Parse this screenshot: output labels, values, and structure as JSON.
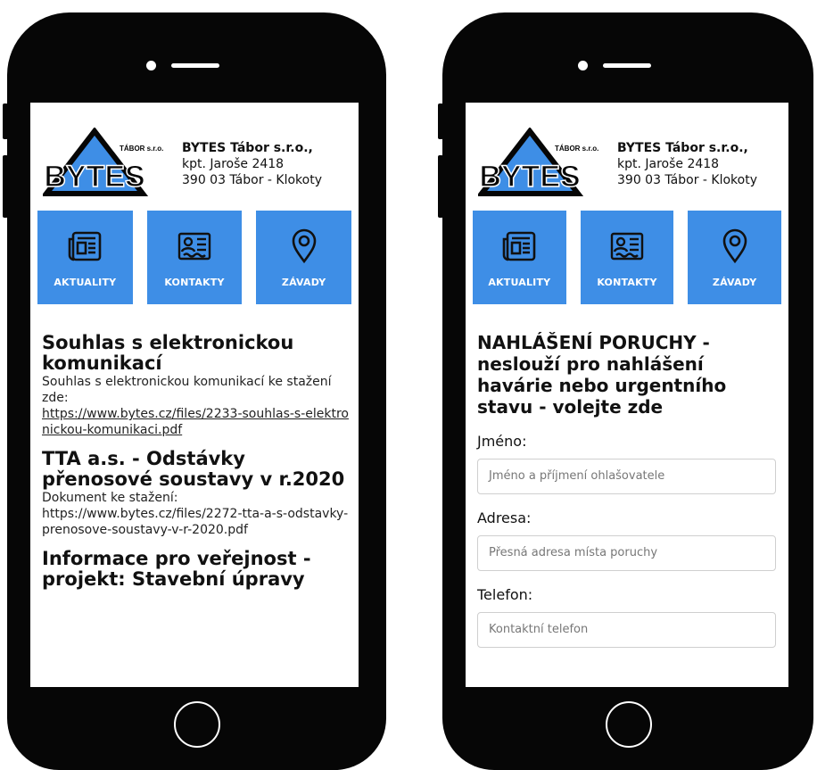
{
  "company": {
    "name": "BYTES Tábor s.r.o.,",
    "street": "kpt. Jaroše 2418",
    "city": "390 03 Tábor - Klokoty",
    "logo_text": "BYTES",
    "logo_subtext": "TÁBOR s.r.o."
  },
  "tiles": [
    {
      "label": "AKTUALITY",
      "icon": "newspaper-icon"
    },
    {
      "label": "KONTAKTY",
      "icon": "contact-card-icon"
    },
    {
      "label": "ZÁVADY",
      "icon": "location-pin-icon"
    }
  ],
  "news": [
    {
      "title": "Souhlas s elektronickou komunikací",
      "text": "Souhlas s elektronickou komunikací ke stažení zde:",
      "link": "https://www.bytes.cz/files/2233-souhlas-s-elektronickou-komunikaci.pdf"
    },
    {
      "title": "TTA a.s. - Odstávky přenosové soustavy v r.2020",
      "text": "Dokument ke stažení:",
      "link": "https://www.bytes.cz/files/2272-tta-a-s-odstavky-prenosove-soustavy-v-r-2020.pdf"
    },
    {
      "title": "Informace pro veřejnost - projekt: Stavební úpravy"
    }
  ],
  "form": {
    "title": "NAHLÁŠENÍ PORUCHY - neslouží pro nahlášení havárie nebo urgentního stavu - volejte zde",
    "fields": [
      {
        "label": "Jméno:",
        "placeholder": "Jméno a příjmení ohlašovatele"
      },
      {
        "label": "Adresa:",
        "placeholder": "Přesná adresa místa poruchy"
      },
      {
        "label": "Telefon:",
        "placeholder": "Kontaktní telefon"
      }
    ]
  },
  "colors": {
    "tile": "#3e8ee6",
    "phone": "#060606",
    "logo_blue": "#3e8ee6"
  }
}
